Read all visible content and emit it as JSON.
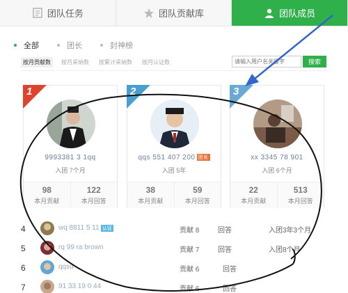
{
  "tabs": [
    {
      "label": "团队任务",
      "icon": "document-icon"
    },
    {
      "label": "团队贡献库",
      "icon": "star-icon"
    },
    {
      "label": "团队成员",
      "icon": "user-icon",
      "active": true
    }
  ],
  "filters": [
    {
      "label": "全部",
      "active": true
    },
    {
      "label": "团长"
    },
    {
      "label": "封神榜"
    }
  ],
  "sort_options": [
    "按月贡献数",
    "按月采纳数",
    "按累计采纳数",
    "按月认证数"
  ],
  "search": {
    "placeholder": "请输入用户名关键字",
    "button": "搜索"
  },
  "cards": [
    {
      "rank": "1",
      "name": "9993381 3 1qq",
      "joined": "入团 7个月",
      "contrib": "98",
      "contrib_label": "本月贡献",
      "answers": "122",
      "answers_label": "本月回答",
      "rank_color": "#e0432b"
    },
    {
      "rank": "2",
      "name": "qqs 551 407 200",
      "leader": "团长",
      "joined": "入团 5年",
      "contrib": "38",
      "contrib_label": "本月贡献",
      "answers": "59",
      "answers_label": "本月回答",
      "rank_color": "#4a9fd1"
    },
    {
      "rank": "3",
      "name": "xx 3345 78 901",
      "joined": "入团 6个月",
      "contrib": "22",
      "contrib_label": "本月贡献",
      "answers": "513",
      "answers_label": "本月回答",
      "rank_color": "#6aa8d6"
    }
  ],
  "list": [
    {
      "rank": "4",
      "name": "wq 8811 5 11",
      "badge": "认证",
      "contrib_label": "贡献",
      "contrib": "8",
      "answer_label": "回答",
      "joined": "入团3年3个月"
    },
    {
      "rank": "5",
      "name": "rq 99 ra brown",
      "contrib_label": "贡献",
      "contrib": "7",
      "answer_label": "回答",
      "joined": "入团8个月"
    },
    {
      "rank": "6",
      "name": "qqsu",
      "contrib_label": "贡献",
      "contrib": "6",
      "answer_label": "回答",
      "joined": ""
    },
    {
      "rank": "7",
      "name": "91 33 19 0 44",
      "contrib_label": "贡献",
      "contrib": "6",
      "answer_label": "回答",
      "joined": ""
    }
  ],
  "colors": {
    "accent": "#2fb04a",
    "annotation": "#111111",
    "arrow": "#3366cc"
  }
}
